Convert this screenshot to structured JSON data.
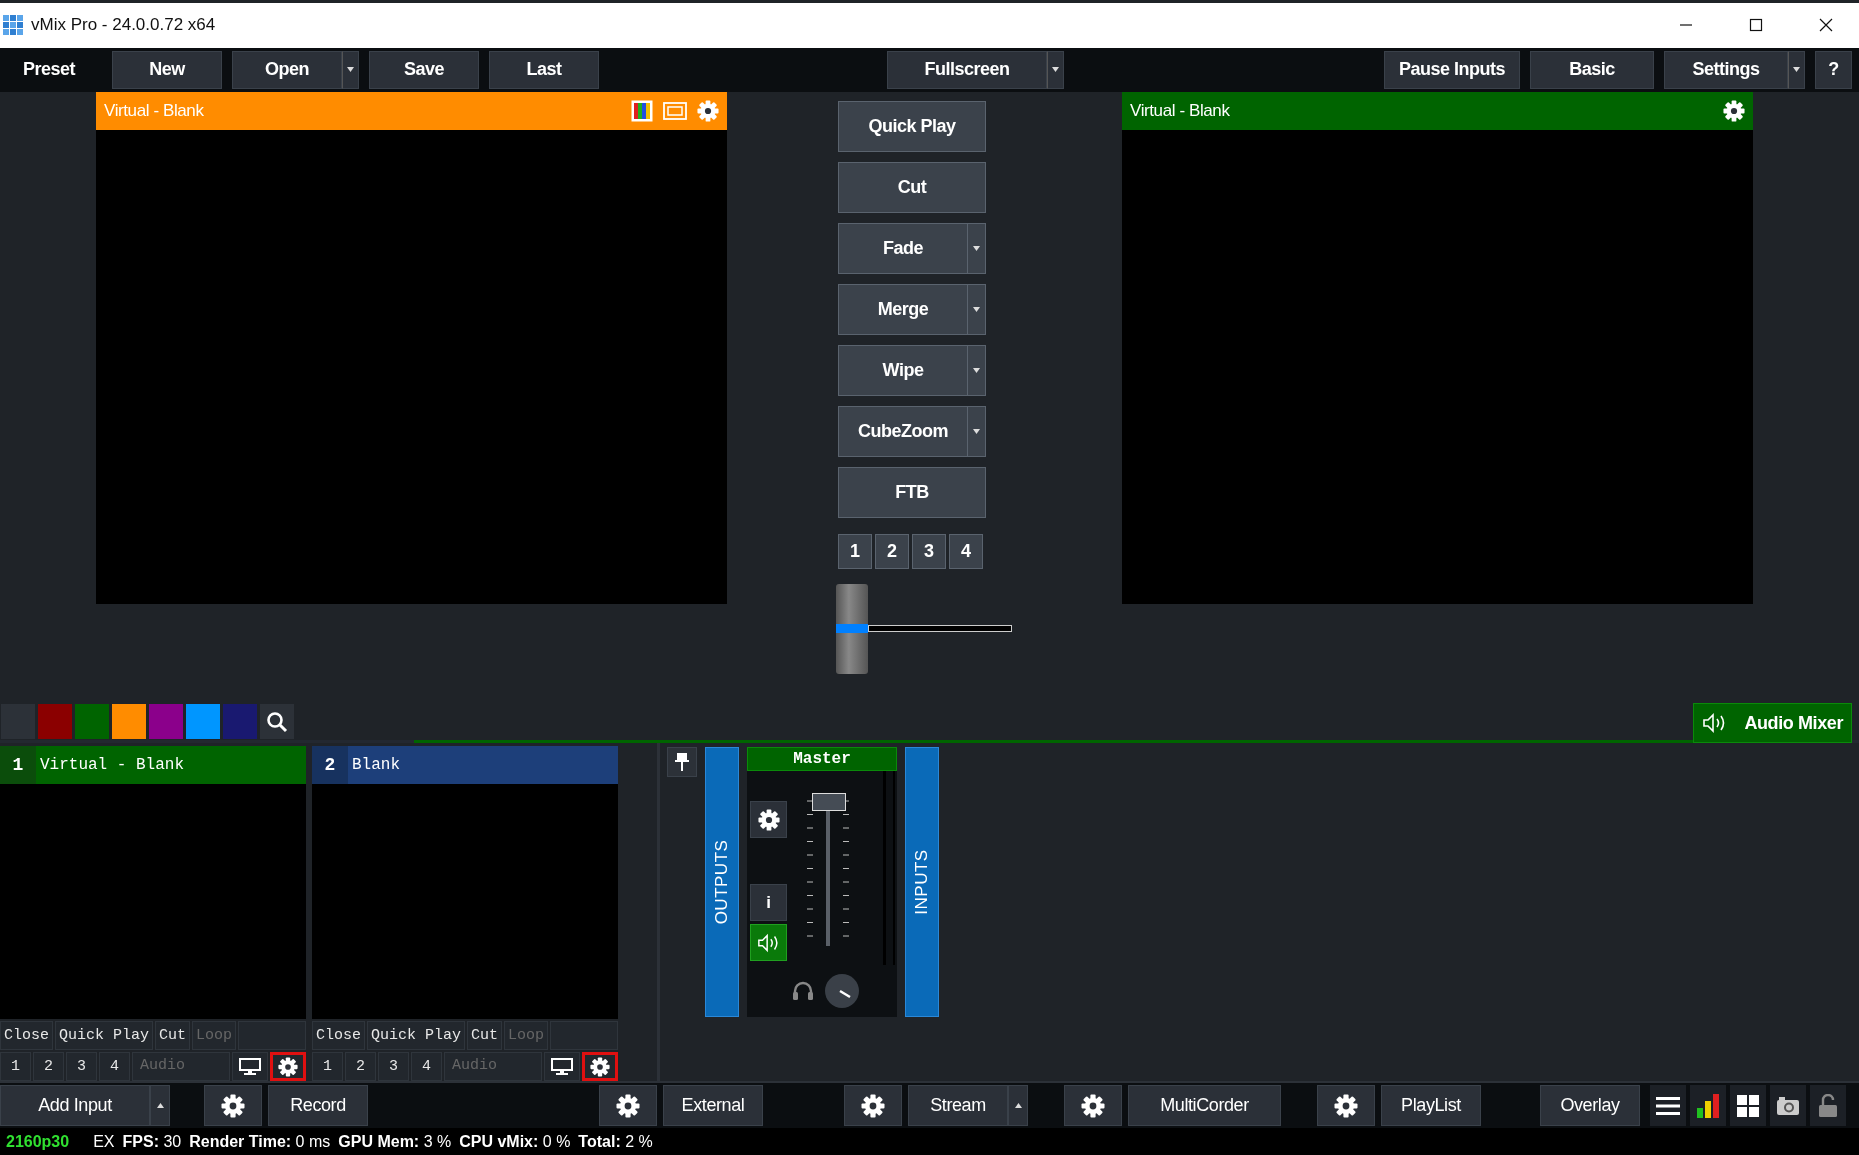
{
  "window": {
    "title": "vMix Pro - 24.0.0.72 x64"
  },
  "toolbar": {
    "label": "Preset",
    "left": [
      {
        "label": "New",
        "dropdown": false
      },
      {
        "label": "Open",
        "dropdown": true
      },
      {
        "label": "Save",
        "dropdown": false
      },
      {
        "label": "Last",
        "dropdown": false
      }
    ],
    "center": [
      {
        "label": "Fullscreen",
        "dropdown": true
      }
    ],
    "right": [
      {
        "label": "Pause Inputs",
        "dropdown": false
      },
      {
        "label": "Basic",
        "dropdown": false
      },
      {
        "label": "Settings",
        "dropdown": true
      },
      {
        "label": "?",
        "dropdown": false
      }
    ]
  },
  "monitors": [
    {
      "kind": "preview",
      "title": "Virtual - Blank"
    },
    {
      "kind": "program",
      "title": "Virtual - Blank"
    }
  ],
  "transitions": [
    {
      "label": "Quick Play",
      "dropdown": false
    },
    {
      "label": "Cut",
      "dropdown": false
    },
    {
      "label": "Fade",
      "dropdown": true
    },
    {
      "label": "Merge",
      "dropdown": true
    },
    {
      "label": "Wipe",
      "dropdown": true
    },
    {
      "label": "CubeZoom",
      "dropdown": true
    },
    {
      "label": "FTB",
      "dropdown": false
    }
  ],
  "transition_numbers": [
    "1",
    "2",
    "3",
    "4"
  ],
  "color_tags": [
    {
      "color": "#2c3138"
    },
    {
      "color": "#8b0000"
    },
    {
      "color": "#006400"
    },
    {
      "color": "#ff8c00"
    },
    {
      "color": "#8b008b"
    },
    {
      "color": "#0096ff"
    },
    {
      "color": "#191970"
    }
  ],
  "inputs": [
    {
      "number": "1",
      "title": "Virtual - Blank",
      "kind": "live",
      "highlight_settings": true,
      "actions": [
        {
          "label": "Close",
          "disabled": false
        },
        {
          "label": "Quick Play",
          "disabled": false
        },
        {
          "label": "Cut",
          "disabled": false
        },
        {
          "label": "Loop",
          "disabled": true
        }
      ],
      "overlays": [
        "1",
        "2",
        "3",
        "4"
      ],
      "audio": {
        "label": "Audio",
        "disabled": true
      }
    },
    {
      "number": "2",
      "title": "Blank",
      "kind": "idle",
      "highlight_settings": true,
      "actions": [
        {
          "label": "Close",
          "disabled": false
        },
        {
          "label": "Quick Play",
          "disabled": false
        },
        {
          "label": "Cut",
          "disabled": false
        },
        {
          "label": "Loop",
          "disabled": true
        }
      ],
      "overlays": [
        "1",
        "2",
        "3",
        "4"
      ],
      "audio": {
        "label": "Audio",
        "disabled": true
      }
    }
  ],
  "audio_mixer": {
    "button": "Audio Mixer",
    "outputs_label": "OUTPUTS",
    "inputs_label": "INPUTS",
    "master": {
      "name": "Master",
      "info_label": "i",
      "level": 1,
      "audio_on": true
    }
  },
  "bottom_bar": [
    {
      "label": "Add Input",
      "settings": false,
      "dropdown": true
    },
    {
      "label": "Record",
      "settings": true,
      "dropdown": false
    },
    {
      "label": "External",
      "settings": true,
      "dropdown": false
    },
    {
      "label": "Stream",
      "settings": true,
      "dropdown": true
    },
    {
      "label": "MultiCorder",
      "settings": true,
      "dropdown": false
    },
    {
      "label": "PlayList",
      "settings": true,
      "dropdown": false
    },
    {
      "label": "Overlay",
      "settings": false,
      "dropdown": false
    }
  ],
  "status_bar": {
    "format": "2160p30",
    "mode": "EX",
    "stats": [
      {
        "label": "FPS:",
        "value": "30"
      },
      {
        "label": "Render Time:",
        "value": "0 ms"
      },
      {
        "label": "GPU Mem:",
        "value": "3 %"
      },
      {
        "label": "CPU vMix:",
        "value": "0 %"
      },
      {
        "label": "Total:",
        "value": "2 %"
      }
    ]
  }
}
